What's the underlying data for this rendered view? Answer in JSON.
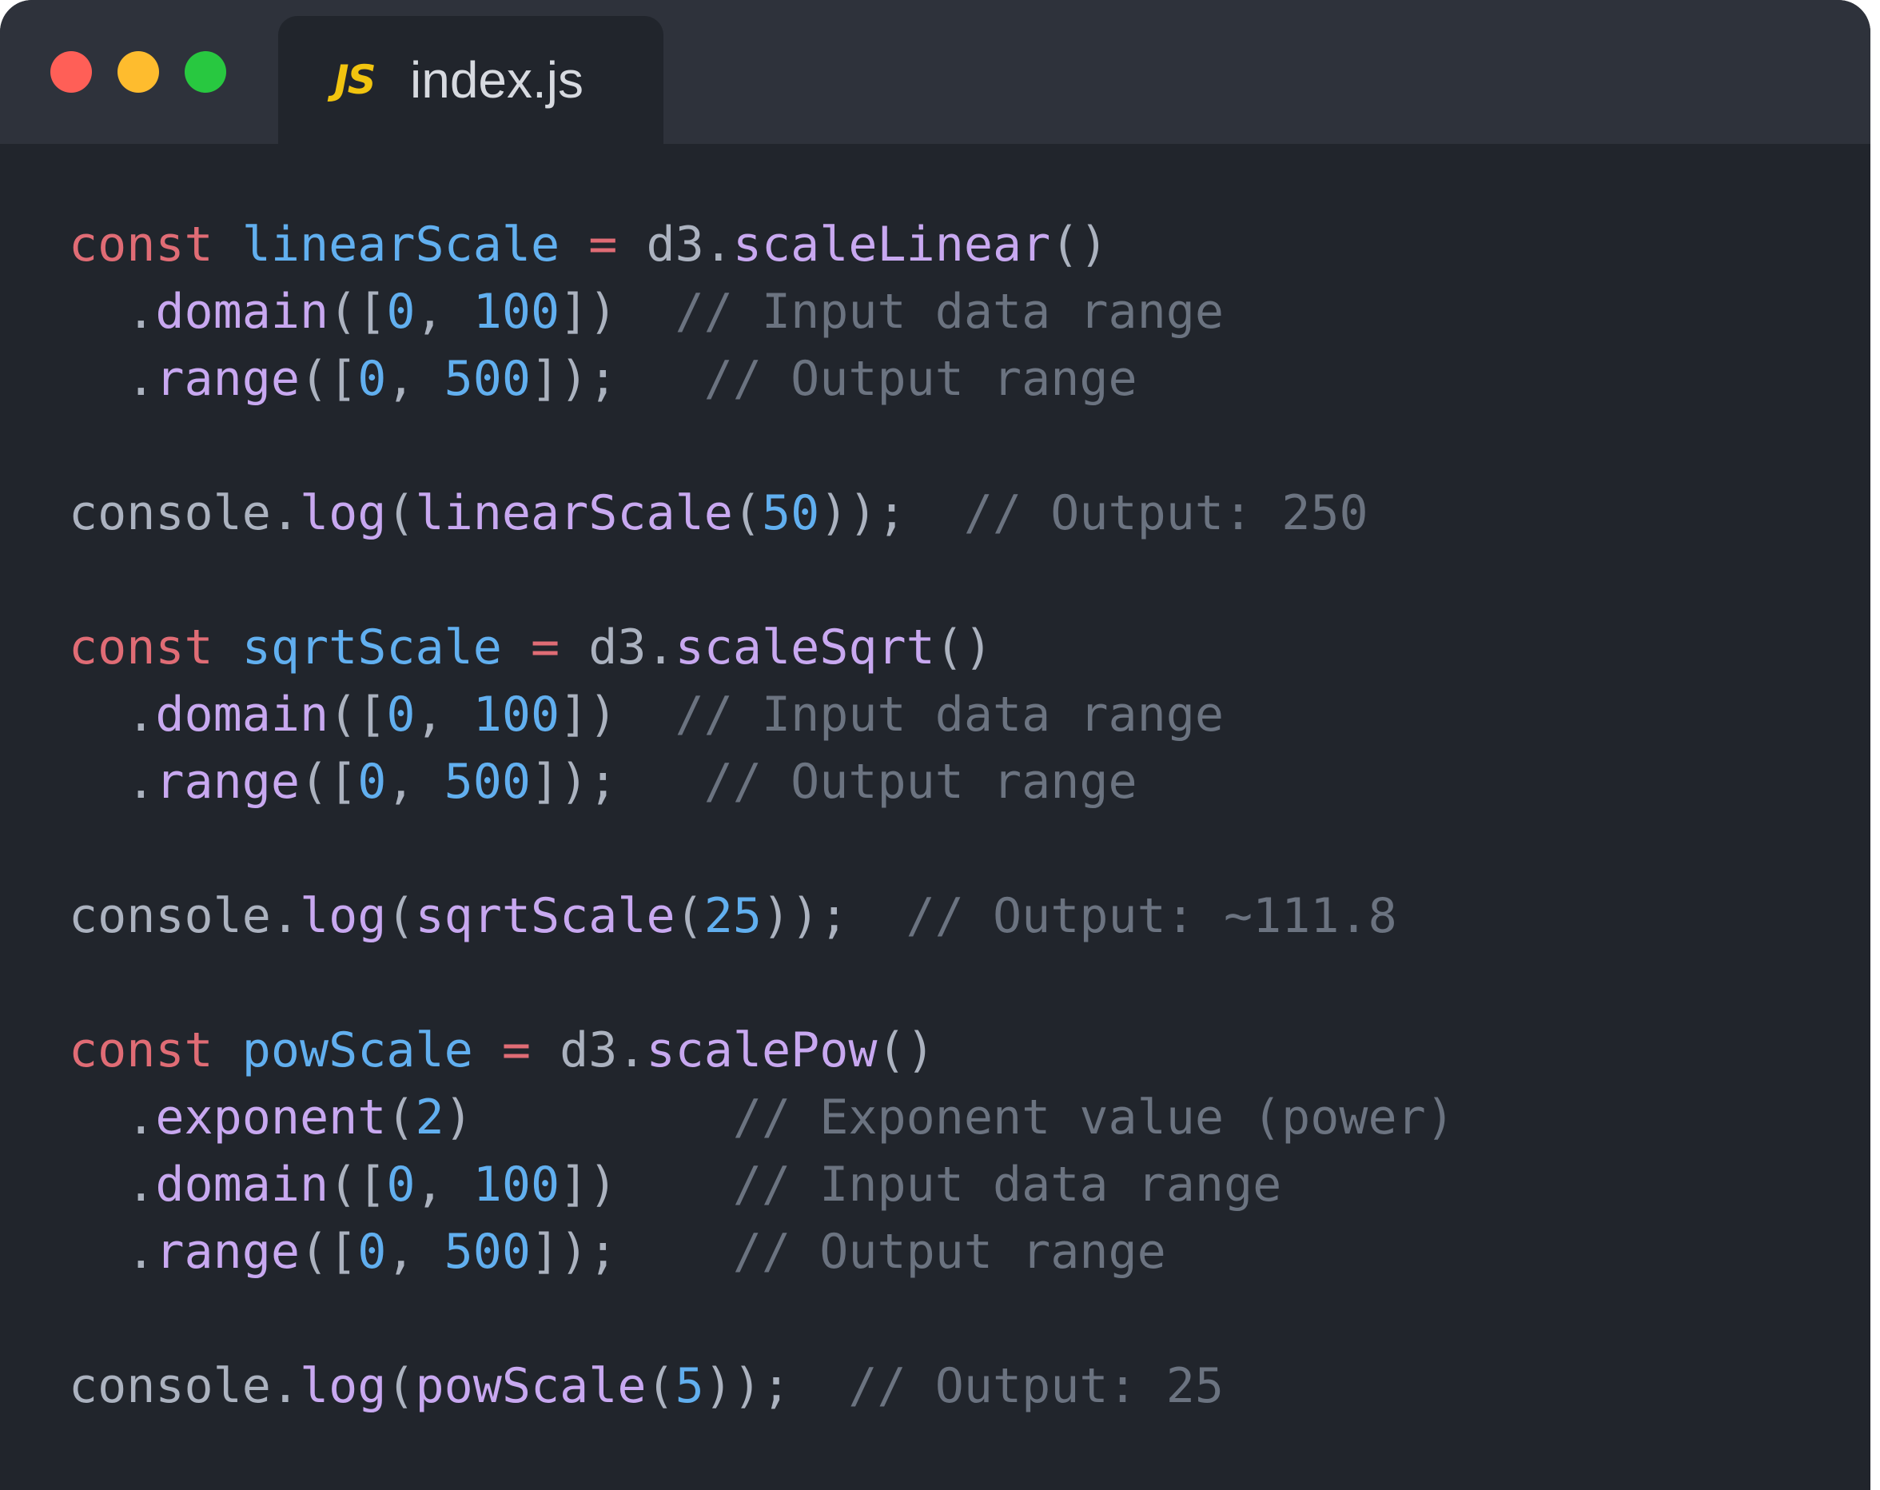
{
  "window": {
    "controls": [
      "close",
      "minimize",
      "maximize"
    ]
  },
  "tab": {
    "icon_text": "JS",
    "icon_name": "javascript-file-icon",
    "label": "index.js"
  },
  "colors": {
    "keyword": "#e06c75",
    "variable": "#61afef",
    "function": "#c8a8f0",
    "number": "#61afef",
    "plain": "#abb2bf",
    "comment": "#6b7380",
    "background": "#21252c",
    "titlebar": "#2e323b"
  },
  "code": {
    "lines": [
      [
        [
          "kw",
          "const"
        ],
        [
          "pl",
          " "
        ],
        [
          "var",
          "linearScale"
        ],
        [
          "pl",
          " "
        ],
        [
          "op",
          "="
        ],
        [
          "pl",
          " d3."
        ],
        [
          "fn",
          "scaleLinear"
        ],
        [
          "pl",
          "()"
        ]
      ],
      [
        [
          "pl",
          "  ."
        ],
        [
          "fn",
          "domain"
        ],
        [
          "pl",
          "(["
        ],
        [
          "num",
          "0"
        ],
        [
          "pl",
          ", "
        ],
        [
          "num",
          "100"
        ],
        [
          "pl",
          "])  "
        ],
        [
          "cm",
          "// Input data range"
        ]
      ],
      [
        [
          "pl",
          "  ."
        ],
        [
          "fn",
          "range"
        ],
        [
          "pl",
          "(["
        ],
        [
          "num",
          "0"
        ],
        [
          "pl",
          ", "
        ],
        [
          "num",
          "500"
        ],
        [
          "pl",
          "]);   "
        ],
        [
          "cm",
          "// Output range"
        ]
      ],
      [],
      [
        [
          "pl",
          "console."
        ],
        [
          "fn",
          "log"
        ],
        [
          "pl",
          "("
        ],
        [
          "fn",
          "linearScale"
        ],
        [
          "pl",
          "("
        ],
        [
          "num",
          "50"
        ],
        [
          "pl",
          "));  "
        ],
        [
          "cm",
          "// Output: 250"
        ]
      ],
      [],
      [
        [
          "kw",
          "const"
        ],
        [
          "pl",
          " "
        ],
        [
          "var",
          "sqrtScale"
        ],
        [
          "pl",
          " "
        ],
        [
          "op",
          "="
        ],
        [
          "pl",
          " d3."
        ],
        [
          "fn",
          "scaleSqrt"
        ],
        [
          "pl",
          "()"
        ]
      ],
      [
        [
          "pl",
          "  ."
        ],
        [
          "fn",
          "domain"
        ],
        [
          "pl",
          "(["
        ],
        [
          "num",
          "0"
        ],
        [
          "pl",
          ", "
        ],
        [
          "num",
          "100"
        ],
        [
          "pl",
          "])  "
        ],
        [
          "cm",
          "// Input data range"
        ]
      ],
      [
        [
          "pl",
          "  ."
        ],
        [
          "fn",
          "range"
        ],
        [
          "pl",
          "(["
        ],
        [
          "num",
          "0"
        ],
        [
          "pl",
          ", "
        ],
        [
          "num",
          "500"
        ],
        [
          "pl",
          "]);   "
        ],
        [
          "cm",
          "// Output range"
        ]
      ],
      [],
      [
        [
          "pl",
          "console."
        ],
        [
          "fn",
          "log"
        ],
        [
          "pl",
          "("
        ],
        [
          "fn",
          "sqrtScale"
        ],
        [
          "pl",
          "("
        ],
        [
          "num",
          "25"
        ],
        [
          "pl",
          "));  "
        ],
        [
          "cm",
          "// Output: ~111.8"
        ]
      ],
      [],
      [
        [
          "kw",
          "const"
        ],
        [
          "pl",
          " "
        ],
        [
          "var",
          "powScale"
        ],
        [
          "pl",
          " "
        ],
        [
          "op",
          "="
        ],
        [
          "pl",
          " d3."
        ],
        [
          "fn",
          "scalePow"
        ],
        [
          "pl",
          "()"
        ]
      ],
      [
        [
          "pl",
          "  ."
        ],
        [
          "fn",
          "exponent"
        ],
        [
          "pl",
          "("
        ],
        [
          "num",
          "2"
        ],
        [
          "pl",
          ")         "
        ],
        [
          "cm",
          "// Exponent value (power)"
        ]
      ],
      [
        [
          "pl",
          "  ."
        ],
        [
          "fn",
          "domain"
        ],
        [
          "pl",
          "(["
        ],
        [
          "num",
          "0"
        ],
        [
          "pl",
          ", "
        ],
        [
          "num",
          "100"
        ],
        [
          "pl",
          "])    "
        ],
        [
          "cm",
          "// Input data range"
        ]
      ],
      [
        [
          "pl",
          "  ."
        ],
        [
          "fn",
          "range"
        ],
        [
          "pl",
          "(["
        ],
        [
          "num",
          "0"
        ],
        [
          "pl",
          ", "
        ],
        [
          "num",
          "500"
        ],
        [
          "pl",
          "]);    "
        ],
        [
          "cm",
          "// Output range"
        ]
      ],
      [],
      [
        [
          "pl",
          "console."
        ],
        [
          "fn",
          "log"
        ],
        [
          "pl",
          "("
        ],
        [
          "fn",
          "powScale"
        ],
        [
          "pl",
          "("
        ],
        [
          "num",
          "5"
        ],
        [
          "pl",
          "));  "
        ],
        [
          "cm",
          "// Output: 25"
        ]
      ]
    ]
  }
}
